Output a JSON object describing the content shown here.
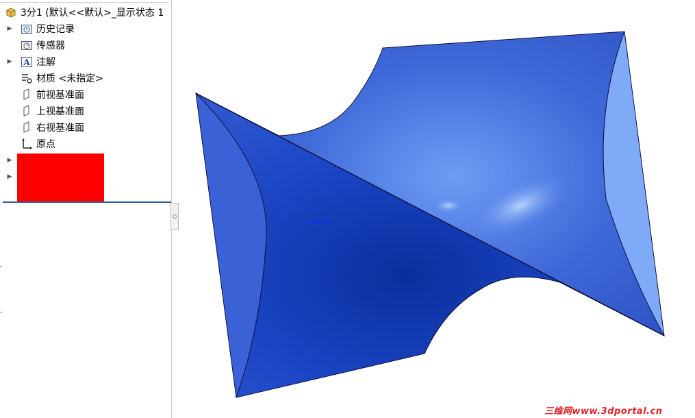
{
  "feature_tree": {
    "root_label": "3分1  (默认<<默认>_显示状态 1",
    "items": [
      {
        "label": "历史记录",
        "icon": "history-folder-icon",
        "expandable": true
      },
      {
        "label": "传感器",
        "icon": "sensor-icon",
        "expandable": false
      },
      {
        "label": "注解",
        "icon": "annotation-icon",
        "expandable": true
      },
      {
        "label": "材质 <未指定>",
        "icon": "material-icon",
        "expandable": false
      },
      {
        "label": "前视基准面",
        "icon": "plane-icon",
        "expandable": false
      },
      {
        "label": "上视基准面",
        "icon": "plane-icon",
        "expandable": false
      },
      {
        "label": "右视基准面",
        "icon": "plane-icon",
        "expandable": false
      },
      {
        "label": "原点",
        "icon": "origin-icon",
        "expandable": false
      }
    ],
    "redacted_color": "#ff0000"
  },
  "graphics": {
    "part_color": "#2448c8",
    "highlight_color": "#7fb0ff",
    "shadow_color": "#0a2a9a"
  },
  "watermark": "三维网www.3dportal.cn"
}
